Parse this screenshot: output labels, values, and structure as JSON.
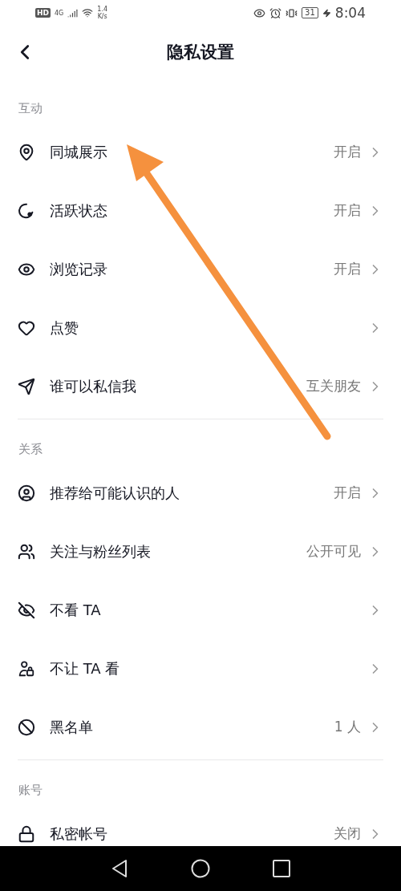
{
  "status_bar": {
    "hd": "HD",
    "network": "4G",
    "speed_value": "1.4",
    "speed_unit": "K/s",
    "battery": "31",
    "time": "8:04"
  },
  "header": {
    "title": "隐私设置"
  },
  "sections": [
    {
      "title": "互动",
      "items": [
        {
          "label": "同城展示",
          "value": "开启"
        },
        {
          "label": "活跃状态",
          "value": "开启"
        },
        {
          "label": "浏览记录",
          "value": "开启"
        },
        {
          "label": "点赞"
        },
        {
          "label": "谁可以私信我",
          "value": "互关朋友"
        }
      ]
    },
    {
      "title": "关系",
      "items": [
        {
          "label": "推荐给可能认识的人",
          "value": "开启"
        },
        {
          "label": "关注与粉丝列表",
          "value": "公开可见"
        },
        {
          "label": "不看 TA"
        },
        {
          "label": "不让 TA 看"
        },
        {
          "label": "黑名单",
          "value": "1 人"
        }
      ]
    },
    {
      "title": "账号",
      "items": [
        {
          "label": "私密帐号",
          "value": "关闭"
        }
      ]
    }
  ]
}
